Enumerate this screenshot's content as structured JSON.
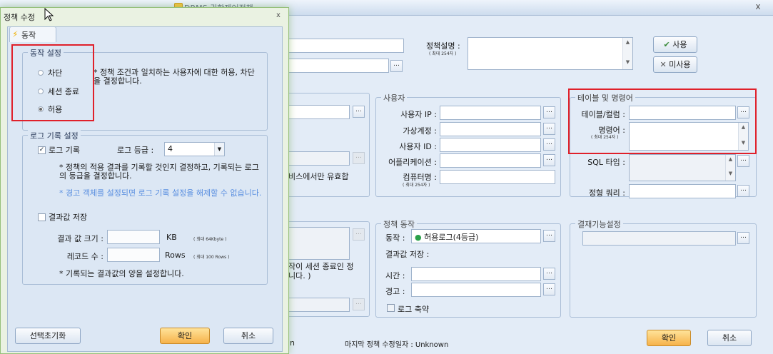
{
  "background_window": {
    "title": "DRMS 권한제어정책",
    "close": "x",
    "policy_desc_label": "정책설명 :",
    "policy_desc_hint": "( 최대 254자 )",
    "use_button": "사용",
    "unuse_button": "미사용",
    "user_group": {
      "title": "사용자",
      "user_ip_label": "사용자 IP :",
      "virtual_account_label": "가상계정 :",
      "user_id_label": "사용자 ID :",
      "application_label": "어플리케이션 :",
      "computer_name_label": "컴퓨터명 :",
      "computer_name_hint": "( 최대 254자 )"
    },
    "partial_text_service": "비스에서만 유효합",
    "table_group": {
      "title": "테이블 및 명령어",
      "table_column_label": "테이블/컬럼 :",
      "command_label": "명령어 :",
      "command_hint": "( 최대 254자 )",
      "sql_type_label": "SQL 타입 :",
      "fixed_query_label": "정형 쿼리 :"
    },
    "policy_action_group": {
      "title": "정책 동작",
      "action_label": "동작 :",
      "action_value": "허용로그(4등급)",
      "result_save_label": "결과값 저장 :",
      "time_label": "시간 :",
      "warning_label": "경고 :",
      "log_reduce_label": "로그 축약"
    },
    "partial_text_session_1": "작이 세션 종료인 정",
    "partial_text_session_2": "니다. )",
    "approval_group": {
      "title": "결재기능설정"
    },
    "last_modified": "마지막 정책 수정일자 : Unknown",
    "partial_text_bottom": "n",
    "confirm_button": "확인",
    "cancel_button": "취소"
  },
  "dialog": {
    "title": "정책 수정",
    "close": "x",
    "tab_label": "동작",
    "action_group": {
      "title": "동작 설정",
      "options": [
        "차단",
        "세션 종료",
        "허용"
      ],
      "selected": "허용",
      "note": "* 정책 조건과 일치하는 사용자에 대한 허용, 차단을 결정합니다."
    },
    "log_group": {
      "title": "로그 기록 설정",
      "log_record_label": "로그 기록",
      "log_record_checked": true,
      "log_level_label": "로그 등급 :",
      "log_level_value": "4",
      "note1": "* 정책의 적용 결과를 기록할 것인지 결정하고, 기록되는 로그의 등급을 결정합니다.",
      "note2": "* 경고 객체를 설정되면 로그 기록 설정을 해제할 수 없습니다.",
      "result_save_label": "결과값 저장",
      "result_size_label": "결과 값 크기 :",
      "result_size_unit": "KB",
      "result_size_hint": "( 최대 64Kbyte )",
      "record_count_label": "레코드 수 :",
      "record_count_unit": "Rows",
      "record_count_hint": "( 최대 100 Rows )",
      "note3": "* 기록되는 결과값의 양을 설정합니다."
    },
    "reset_button": "선택초기화",
    "confirm_button": "확인",
    "cancel_button": "취소"
  },
  "colors": {
    "highlight_red": "#e0202a",
    "confirm_orange": "#f6b24a",
    "dialog_glow": "#95c07a"
  }
}
